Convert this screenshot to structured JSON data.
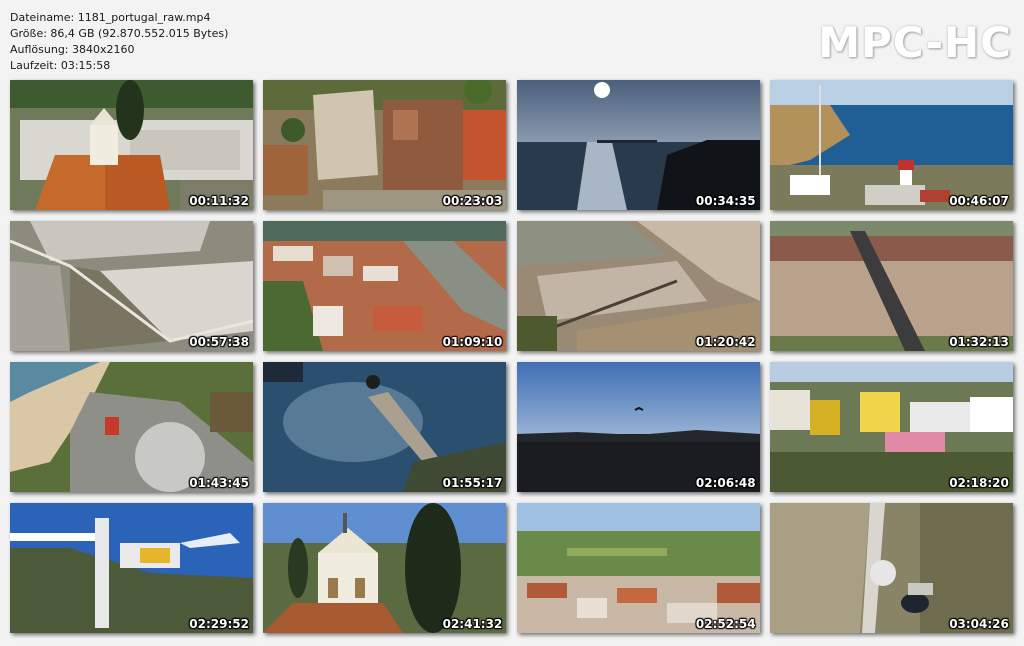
{
  "file_info": {
    "name": "Dateiname: 1181_portugal_raw.mp4",
    "size": "Größe: 86,4 GB (92.870.552.015 Bytes)",
    "resolution": "Auflösung: 3840x2160",
    "duration": "Laufzeit: 03:15:58"
  },
  "logo": "MPC-HC",
  "thumbnails": [
    {
      "time": "00:11:32",
      "scene": "church-rooftop"
    },
    {
      "time": "00:23:03",
      "scene": "castle-ruins"
    },
    {
      "time": "00:34:35",
      "scene": "sun-over-sea"
    },
    {
      "time": "00:46:07",
      "scene": "lighthouse-coast"
    },
    {
      "time": "00:57:38",
      "scene": "salt-fields"
    },
    {
      "time": "01:09:10",
      "scene": "town-river"
    },
    {
      "time": "01:20:42",
      "scene": "marsh-boardwalk"
    },
    {
      "time": "01:32:13",
      "scene": "rail-bridge"
    },
    {
      "time": "01:43:45",
      "scene": "roundabout-beach"
    },
    {
      "time": "01:55:17",
      "scene": "harbor-jetty"
    },
    {
      "time": "02:06:48",
      "scene": "blue-sky-bird"
    },
    {
      "time": "02:18:20",
      "scene": "colorful-houses"
    },
    {
      "time": "02:29:52",
      "scene": "elevator-tower"
    },
    {
      "time": "02:41:32",
      "scene": "church-cypress"
    },
    {
      "time": "02:52:54",
      "scene": "town-fields"
    },
    {
      "time": "03:04:26",
      "scene": "radar-dome"
    }
  ]
}
